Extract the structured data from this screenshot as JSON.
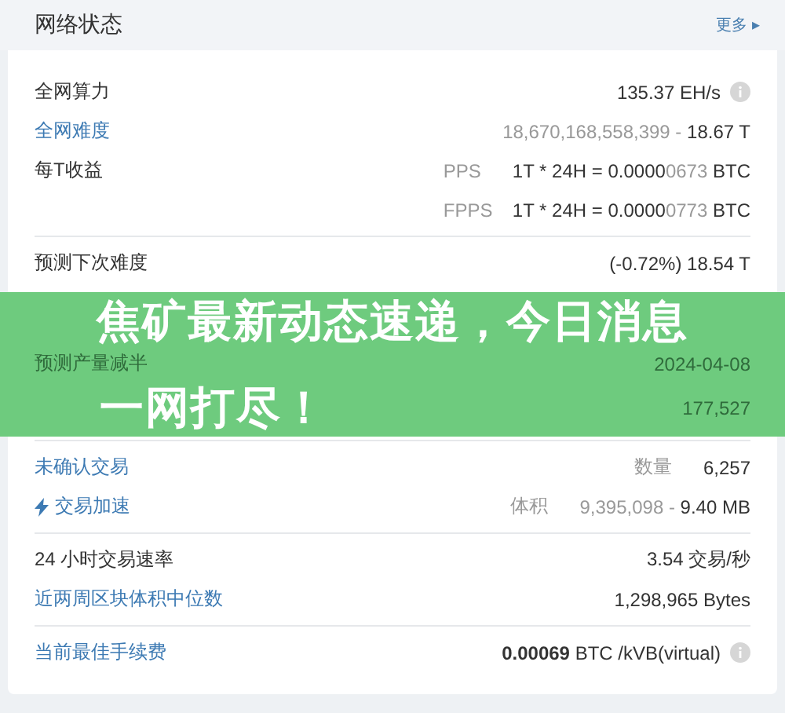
{
  "header": {
    "title": "网络状态",
    "more": "更多",
    "more_arrow": "▸"
  },
  "sections": [
    {
      "rows": [
        {
          "label": "全网算力",
          "link": false,
          "icon": false,
          "value": [
            {
              "text": "135.37 EH/s",
              "muted": false
            }
          ],
          "info": true
        },
        {
          "label": "全网难度",
          "link": true,
          "icon": false,
          "value": [
            {
              "text": "18,670,168,558,399 - ",
              "muted": true
            },
            {
              "text": "18.67 T",
              "muted": false
            }
          ],
          "info": false
        },
        {
          "label": "每T收益",
          "link": false,
          "icon": false,
          "sub": "PPS",
          "value": [
            {
              "text": "1T * 24H = 0.0000",
              "muted": false
            },
            {
              "text": "0673",
              "muted": true
            },
            {
              "text": " BTC",
              "muted": false
            }
          ],
          "info": false
        },
        {
          "icon": false,
          "sub": "FPPS",
          "value": [
            {
              "text": "1T * 24H = 0.0000",
              "muted": false
            },
            {
              "text": "0773",
              "muted": true
            },
            {
              "text": " BTC",
              "muted": false
            }
          ],
          "info": false
        }
      ]
    },
    {
      "rows": [
        {
          "label": "预测下次难度",
          "link": false,
          "icon": false,
          "value": [
            {
              "text": "(-0.72%) 18.54 T",
              "muted": false
            }
          ],
          "info": false
        }
      ]
    },
    {
      "rows": [
        {
          "label": "未确认交易",
          "link": true,
          "icon": false,
          "sub": "数量",
          "value": [
            {
              "text": "6,257",
              "muted": false
            }
          ],
          "info": false
        },
        {
          "label": "交易加速",
          "link": true,
          "icon": true,
          "sub": "体积",
          "value": [
            {
              "text": "9,395,098 - ",
              "muted": true
            },
            {
              "text": "9.40 MB",
              "muted": false
            }
          ],
          "info": false
        }
      ]
    },
    {
      "rows": [
        {
          "label": "24 小时交易速率",
          "link": false,
          "icon": false,
          "value": [
            {
              "text": "3.54 交易/秒",
              "muted": false
            }
          ],
          "info": false
        },
        {
          "label": "近两周区块体积中位数",
          "link": true,
          "icon": false,
          "value": [
            {
              "text": "1,298,965 Bytes",
              "muted": false
            }
          ],
          "info": false
        }
      ]
    },
    {
      "rows": [
        {
          "label": "当前最佳手续费",
          "link": true,
          "icon": false,
          "value": [
            {
              "text": "0.00069",
              "muted": false,
              "bold": true
            },
            {
              "text": " BTC /kVB(virtual)",
              "muted": false,
              "bold": false
            }
          ],
          "info": true
        }
      ]
    }
  ],
  "banner": {
    "line_1": "焦矿最新动态速递，今日消息",
    "under_label": "预测产量减半",
    "under_value": "2024-04-08",
    "line_2": "一网打尽！",
    "under_value_2": "177,527"
  }
}
